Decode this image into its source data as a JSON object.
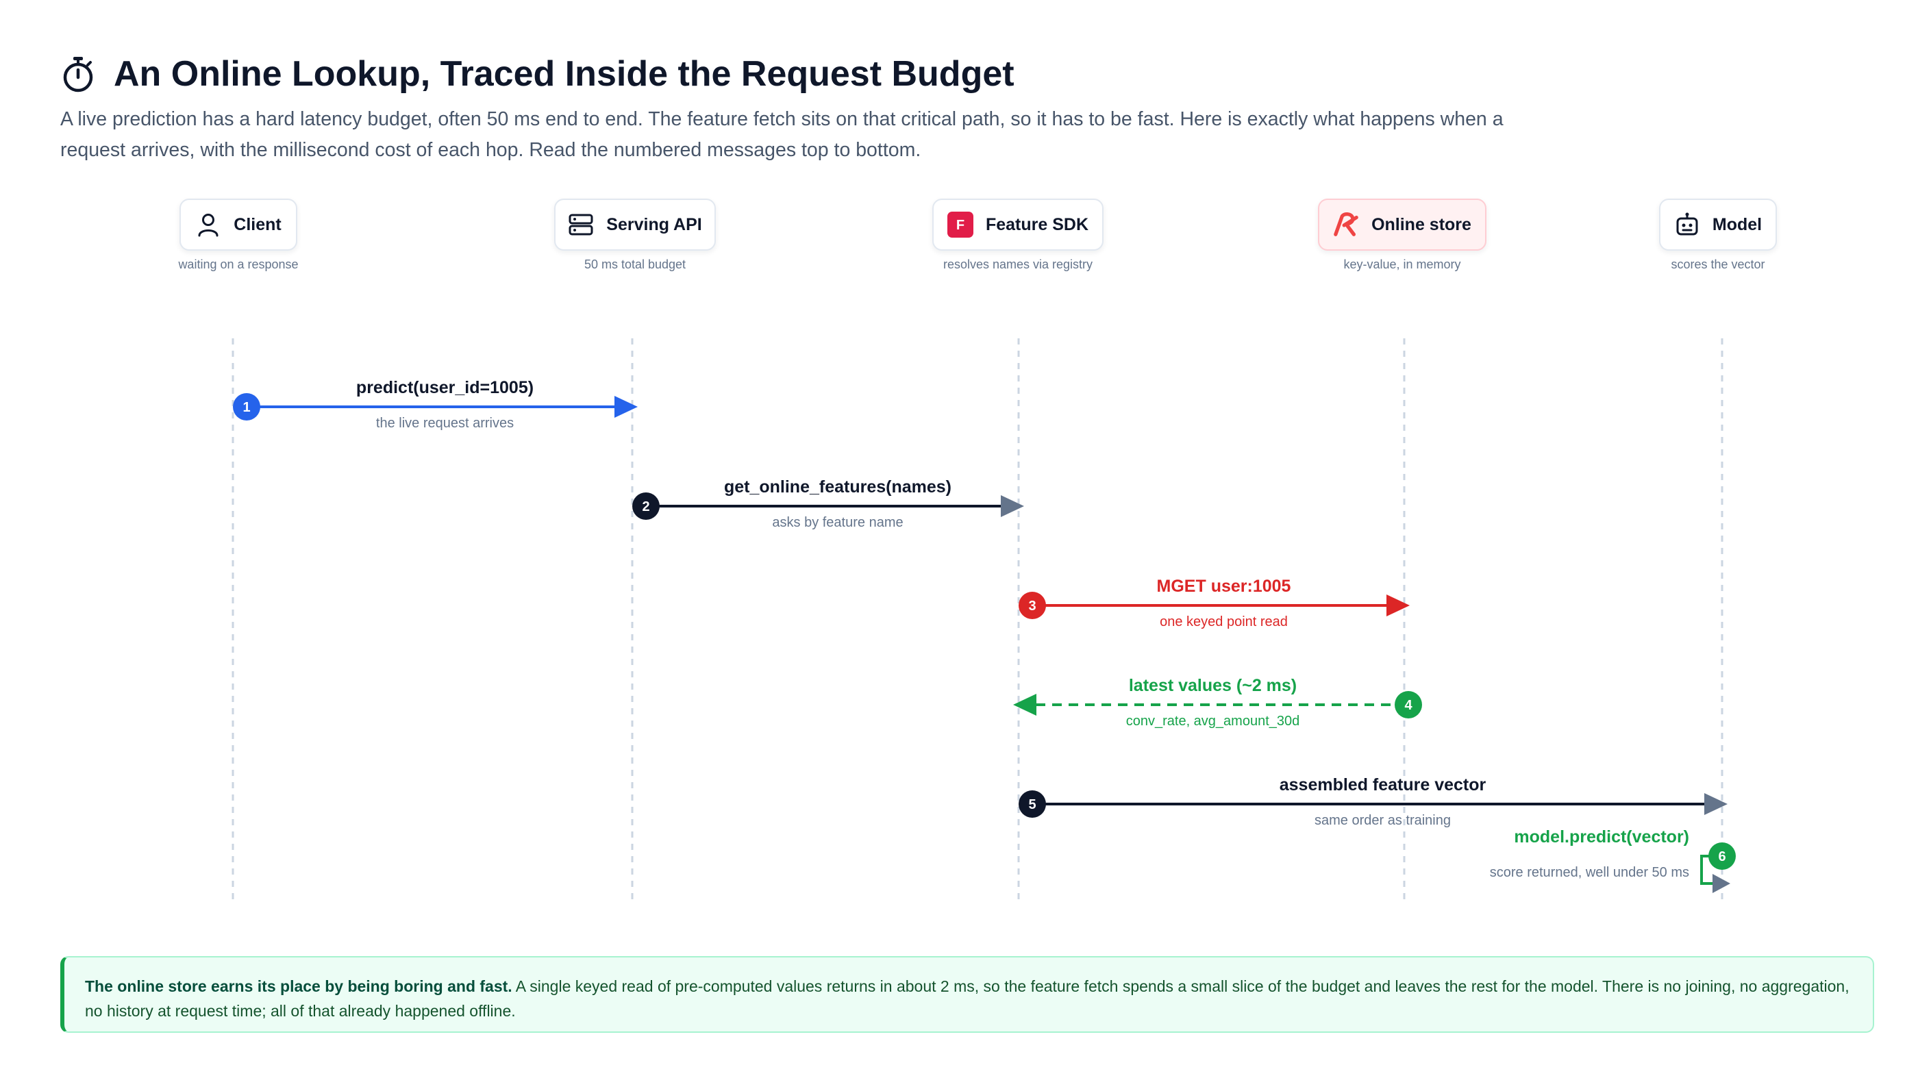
{
  "header": {
    "title": "An Online Lookup, Traced Inside the Request Budget",
    "title_icon": "stopwatch-icon",
    "subtitle_line1": "A live prediction has a hard latency budget, often 50 ms end to end. The feature fetch sits on that critical path, so it has to be fast. Here is exactly what happens when a",
    "subtitle_line2": "request arrives, with the millisecond cost of each hop. Read the numbered messages top to bottom."
  },
  "actors": [
    {
      "label": "Client",
      "sub": "waiting on a response",
      "icon": "user-icon"
    },
    {
      "label": "Serving API",
      "sub": "50 ms total budget",
      "icon": "server-icon"
    },
    {
      "label": "Feature SDK",
      "sub": "resolves names via registry",
      "icon": "feature-sdk-logo-icon",
      "logo_letter": "F"
    },
    {
      "label": "Online store",
      "sub": "key-value, in memory",
      "icon": "redis-logo-icon"
    },
    {
      "label": "Model",
      "sub": "scores the vector",
      "icon": "robot-icon"
    }
  ],
  "messages": [
    {
      "step": "1",
      "label": "predict(user_id=1005)",
      "sub": "the live request arrives",
      "from": 0,
      "to": 1,
      "color": "#2563eb",
      "dashed": false
    },
    {
      "step": "2",
      "label": "get_online_features(names)",
      "sub": "asks by feature name",
      "from": 1,
      "to": 2,
      "color": "#0f172a",
      "dashed": false
    },
    {
      "step": "3",
      "label": "MGET user:1005",
      "sub": "one keyed point read",
      "from": 2,
      "to": 3,
      "color": "#dc2626",
      "dashed": false
    },
    {
      "step": "4",
      "label": "latest values (~2 ms)",
      "sub": "conv_rate, avg_amount_30d",
      "from": 3,
      "to": 2,
      "color": "#16a34a",
      "dashed": true
    },
    {
      "step": "5",
      "label": "assembled feature vector",
      "sub": "same order as training",
      "from": 2,
      "to": 4,
      "color": "#0f172a",
      "dashed": false
    },
    {
      "step": "6",
      "label": "model.predict(vector)",
      "sub": "score returned, well under 50 ms",
      "from": 4,
      "to": 4,
      "color": "#16a34a",
      "dashed": false
    }
  ],
  "colors": {
    "blue": "#2563eb",
    "dark": "#0f172a",
    "red": "#dc2626",
    "green": "#16a34a",
    "arrowhead_gray": "#64748b",
    "lifeline": "#cbd5e1"
  },
  "callout": {
    "bold": "The online store earns its place by being boring and fast.",
    "text": " A single keyed read of pre-computed values returns in about 2 ms, so the feature fetch spends a small slice of the budget and leaves the rest for the model. There is no joining, no aggregation, no history at request time; all of that already happened offline."
  }
}
